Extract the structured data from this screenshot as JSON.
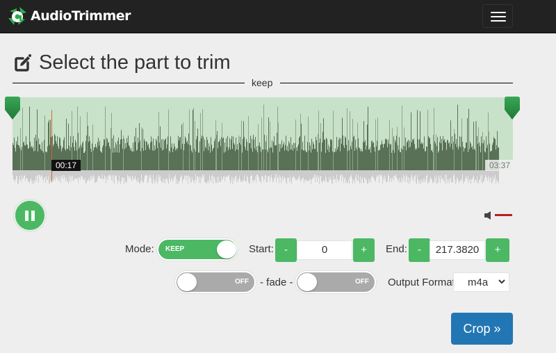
{
  "app": {
    "brand": "AudioTrimmer"
  },
  "navbar": {
    "menu_icon": "hamburger-icon"
  },
  "page": {
    "title": "Select the part to trim",
    "title_icon": "edit-square-icon",
    "divider_label": "keep"
  },
  "player": {
    "current_time": "00:17",
    "total_time": "03:37",
    "state": "playing",
    "play_button_icon": "pause-icon",
    "volume_icon": "speaker-icon",
    "selection": {
      "start_fraction": 0.0,
      "end_fraction": 1.0
    },
    "playhead_fraction": 0.078,
    "colors": {
      "region": "#c8e2ca",
      "wave": "#5a7057",
      "handle": "#2e9447",
      "playhead": "#d2691e",
      "mute_bar": "#b22222"
    }
  },
  "controls": {
    "mode_label": "Mode:",
    "mode_value": "KEEP",
    "start_label": "Start:",
    "start_value": "0",
    "end_label": "End:",
    "end_value": "217.3820",
    "minus": "-",
    "plus": "+",
    "fade_in_value": "OFF",
    "fade_label": "- fade -",
    "fade_out_value": "OFF",
    "output_format_label": "Output Format",
    "output_format_value": "m4a",
    "crop_label": "Crop »"
  },
  "colors": {
    "accent_green": "#4cb863",
    "crop_blue": "#2376b4",
    "navbar": "#222222",
    "background": "#eeeeee"
  }
}
